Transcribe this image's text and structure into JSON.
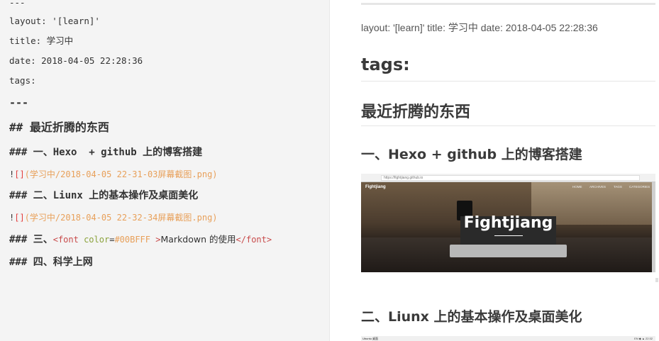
{
  "editor": {
    "lines": {
      "dashes_top": "---",
      "layout": "layout: '[learn]'",
      "title": "title: 学习中",
      "date": "date: 2018-04-05 22:28:36",
      "tags": "tags:",
      "dashes_bottom": "---",
      "h2_prefix": "## ",
      "h2_text": "最近折腾的东西",
      "h3a_prefix": "### ",
      "h3a_text": "一、Hexo  + github 上的博客搭建",
      "img1_bang": "!",
      "img1_brackets": "[]",
      "img1_src": "(学习中/2018-04-05 22-31-03屏幕截图.png)",
      "h3b_prefix": "### ",
      "h3b_text": "二、Liunx 上的基本操作及桌面美化",
      "img2_bang": "!",
      "img2_brackets": "[]",
      "img2_src": "(学习中/2018-04-05 22-32-34屏幕截图.png)",
      "h3c_prefix": "### ",
      "h3c_lead": "三、",
      "h3c_tag_open": "<font",
      "h3c_attr": "color",
      "h3c_eq": "=",
      "h3c_val": "#00BFFF",
      "h3c_gt": ">",
      "h3c_text": "Markdown 的使用",
      "h3c_tag_close": "</font>",
      "h3d_prefix": "### ",
      "h3d_text": "四、科学上网"
    }
  },
  "preview": {
    "meta": "layout: '[learn]' title: 学习中 date: 2018-04-05 22:28:36",
    "tags_heading": "tags:",
    "h2": "最近折腾的东西",
    "h3a": "一、Hexo + github 上的博客搭建",
    "h3b": "二、Liunx 上的基本操作及桌面美化",
    "shot1": {
      "url": "https://fightjiang.github.io",
      "brand": "Fightjiang",
      "nav": [
        "HOME",
        "ARCHIVES",
        "TAGS",
        "CATEGORIES"
      ],
      "title": "Fightjiang"
    },
    "shot2": {
      "title": "Ubuntu 桌面",
      "tray": "EN ◆ ▲ 22:32"
    }
  }
}
